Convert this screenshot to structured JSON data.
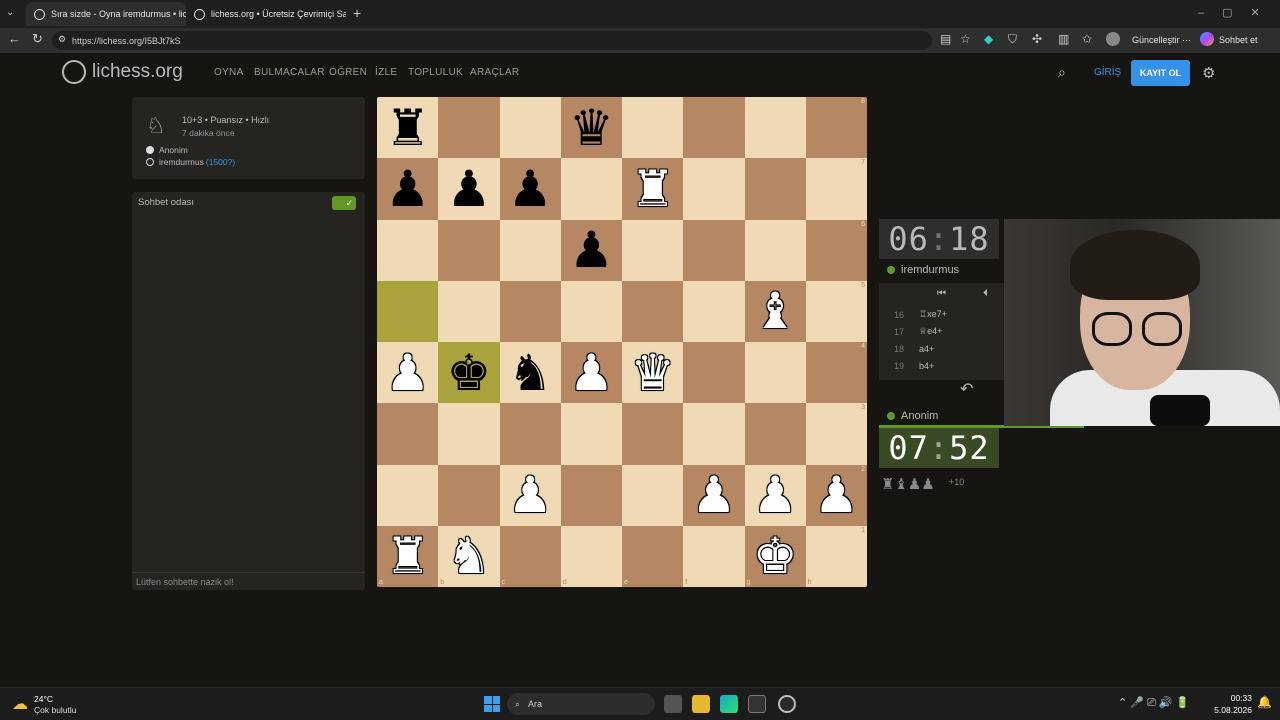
{
  "browser": {
    "tabs": [
      {
        "title": "Sıra sizde - Oyna iremdurmus • lic",
        "active": true
      },
      {
        "title": "lichess.org • Ücretsiz Çevrimiçi Sat",
        "active": false
      }
    ],
    "url": "https://lichess.org/I5BJt7kS",
    "update_label": "Güncelleştir",
    "chat_label": "Sohbet et"
  },
  "site": {
    "logo": "lichess.org",
    "nav": [
      "OYNA",
      "BULMACALAR",
      "ÖĞREN",
      "İZLE",
      "TOPLULUK",
      "ARAÇLAR"
    ],
    "login": "GİRİŞ",
    "signup": "KAYIT OL"
  },
  "game_info": {
    "mode": "10+3 • Puansız • Hızlı",
    "ago": "7 dakika önce",
    "white_player": "Anonim",
    "black_player": "iremdurmus",
    "black_rating": "(1500?)"
  },
  "chat": {
    "title": "Sohbet odası",
    "placeholder": "Lütfen sohbette nazik ol!"
  },
  "board": {
    "ranks": [
      "8",
      "7",
      "6",
      "5",
      "4",
      "3",
      "2",
      "1"
    ],
    "files": [
      "a",
      "b",
      "c",
      "d",
      "e",
      "f",
      "g",
      "h"
    ],
    "position": [
      [
        "bR",
        "",
        "",
        "bQ",
        "",
        "",
        "",
        ""
      ],
      [
        "bP",
        "bP",
        "bP",
        "",
        "wR",
        "",
        "",
        ""
      ],
      [
        "",
        "",
        "",
        "bP",
        "",
        "",
        "",
        ""
      ],
      [
        "",
        "",
        "",
        "",
        "",
        "",
        "wB",
        ""
      ],
      [
        "wP",
        "bK",
        "bN",
        "wP",
        "wQ",
        "",
        "",
        ""
      ],
      [
        "",
        "",
        "",
        "",
        "",
        "",
        "",
        ""
      ],
      [
        "",
        "",
        "wP",
        "",
        "",
        "wP",
        "wP",
        "wP"
      ],
      [
        "wR",
        "wN",
        "",
        "",
        "",
        "",
        "wK",
        ""
      ]
    ],
    "highlight": [
      "a5",
      "b4"
    ]
  },
  "clocks": {
    "top": {
      "min": "06",
      "sec": "18",
      "player": "iremdurmus"
    },
    "bottom": {
      "min": "07",
      "sec": "52",
      "player": "Anonim"
    }
  },
  "moves": [
    {
      "num": "16",
      "san": "♖xe7+"
    },
    {
      "num": "17",
      "san": "♕e4+"
    },
    {
      "num": "18",
      "san": "a4+"
    },
    {
      "num": "19",
      "san": "b4+"
    }
  ],
  "material": {
    "pieces": "♜♝♟♟",
    "diff": "+10"
  },
  "taskbar": {
    "temp": "24°C",
    "weather": "Çok bulutlu",
    "search": "Ara",
    "time": "00:33",
    "date": "5.08.2026"
  }
}
